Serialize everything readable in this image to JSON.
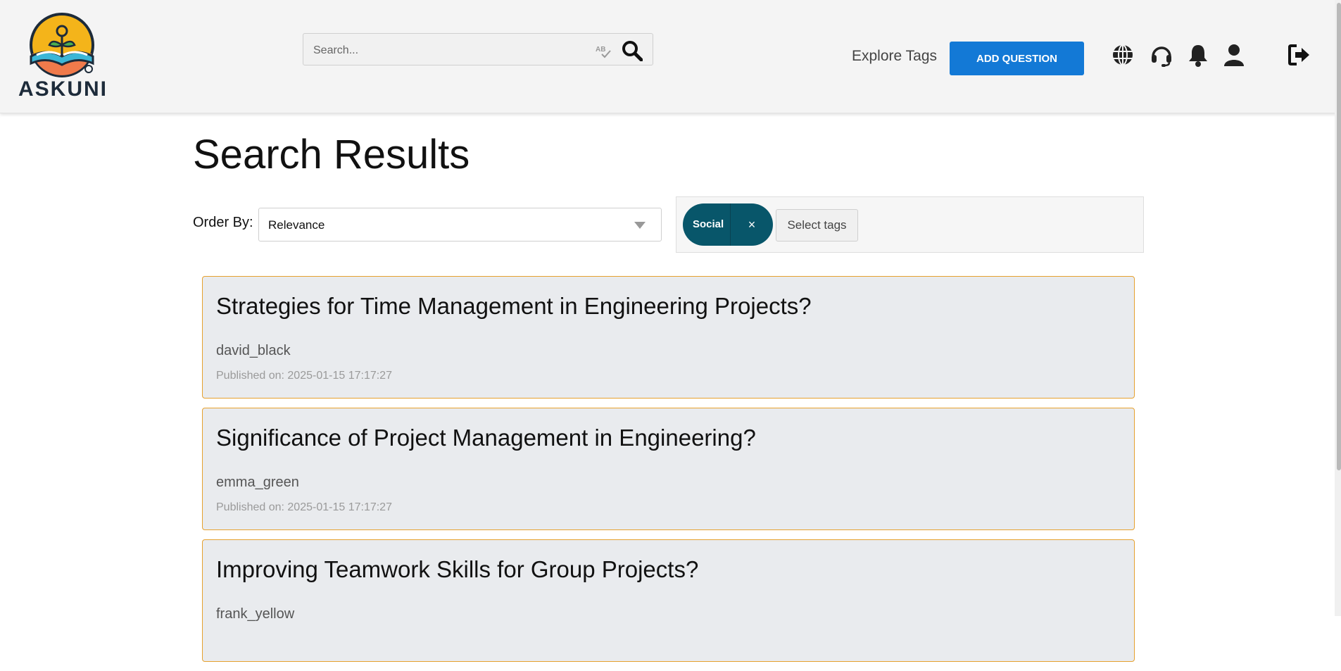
{
  "header": {
    "logo_text": "ASKUNI",
    "search": {
      "placeholder": "Search...",
      "value": ""
    },
    "explore_tags": "Explore Tags",
    "add_question": "ADD QUESTION",
    "icons": [
      "globe-icon",
      "headset-icon",
      "bell-icon",
      "user-icon",
      "logout-icon"
    ]
  },
  "main": {
    "title": "Search Results",
    "order_by": {
      "label": "Order By:",
      "selected": "Relevance"
    },
    "tags": {
      "selected": [
        {
          "label": "Social",
          "remove": "×"
        }
      ],
      "select_button": "Select tags"
    },
    "results": [
      {
        "title": "Strategies for Time Management in Engineering Projects?",
        "author": "david_black",
        "published": "Published on: 2025-01-15 17:17:27"
      },
      {
        "title": "Significance of Project Management in Engineering?",
        "author": "emma_green",
        "published": "Published on: 2025-01-15 17:17:27"
      },
      {
        "title": "Improving Teamwork Skills for Group Projects?",
        "author": "frank_yellow",
        "published": ""
      }
    ]
  },
  "colors": {
    "accent_blue": "#1379d6",
    "tag_teal": "#08566a",
    "card_border": "#e6a12e",
    "card_bg": "#e9ebee",
    "header_bg": "#f4f4f4"
  }
}
